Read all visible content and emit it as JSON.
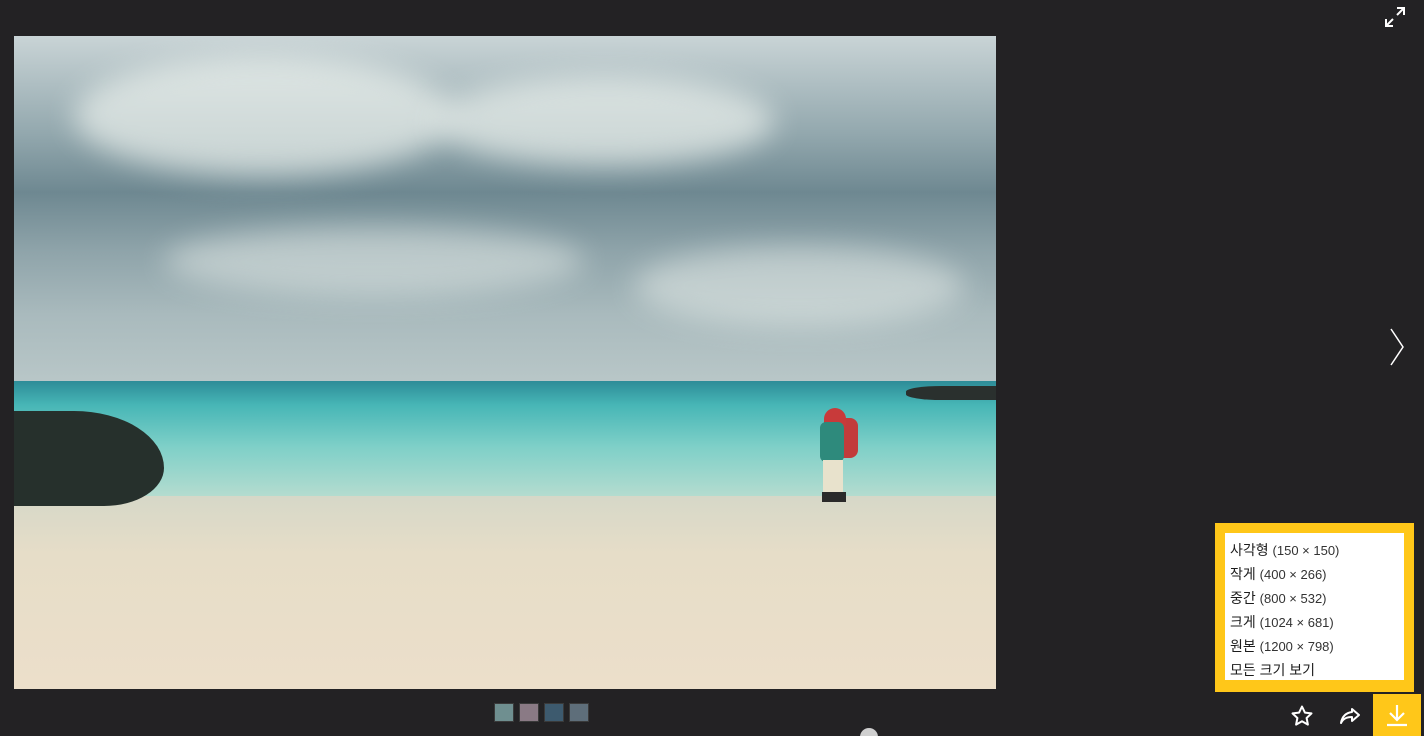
{
  "viewer": {
    "fullscreen_icon": "fullscreen-icon",
    "next_icon": "chevron-right-icon",
    "colors": {
      "background": "#232224",
      "accent": "#ffc719"
    }
  },
  "thumbnails": [
    {
      "color": "#6f8f90"
    },
    {
      "color": "#8a7a85"
    },
    {
      "color": "#3d5a6e"
    },
    {
      "color": "#5e6e7a"
    }
  ],
  "download_menu": {
    "items": [
      {
        "label": "사각형",
        "dims": "(150 × 150)"
      },
      {
        "label": "작게",
        "dims": "(400 × 266)"
      },
      {
        "label": "중간",
        "dims": "(800 × 532)"
      },
      {
        "label": "크게",
        "dims": "(1024 × 681)"
      },
      {
        "label": "원본",
        "dims": "(1200 × 798)"
      },
      {
        "label": "모든 크기 보기",
        "dims": ""
      }
    ]
  },
  "toolbar": {
    "favorite_icon": "star-icon",
    "share_icon": "share-icon",
    "download_icon": "download-icon"
  }
}
